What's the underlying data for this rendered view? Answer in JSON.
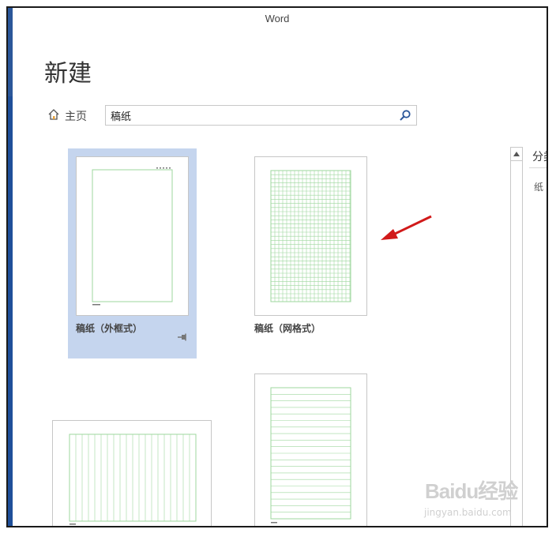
{
  "window": {
    "title": "Word"
  },
  "page": {
    "title": "新建"
  },
  "nav": {
    "home_label": "主页"
  },
  "search": {
    "value": "稿纸",
    "icon": "search-icon"
  },
  "templates": [
    {
      "label": "稿纸（外框式）",
      "selected": true
    },
    {
      "label": "稿纸（网格式）",
      "selected": false
    },
    {
      "label": "",
      "selected": false
    },
    {
      "label": "",
      "selected": false
    }
  ],
  "category_pane": {
    "header": "分类",
    "first_item": "纸"
  },
  "watermark": {
    "logo": "Baidu经验",
    "url": "jingyan.baidu.com"
  },
  "colors": {
    "accent": "#2b579a",
    "selection": "#c5d5ee",
    "paper_lines": "#9ed79e",
    "annotation_arrow": "#d11a1a"
  }
}
